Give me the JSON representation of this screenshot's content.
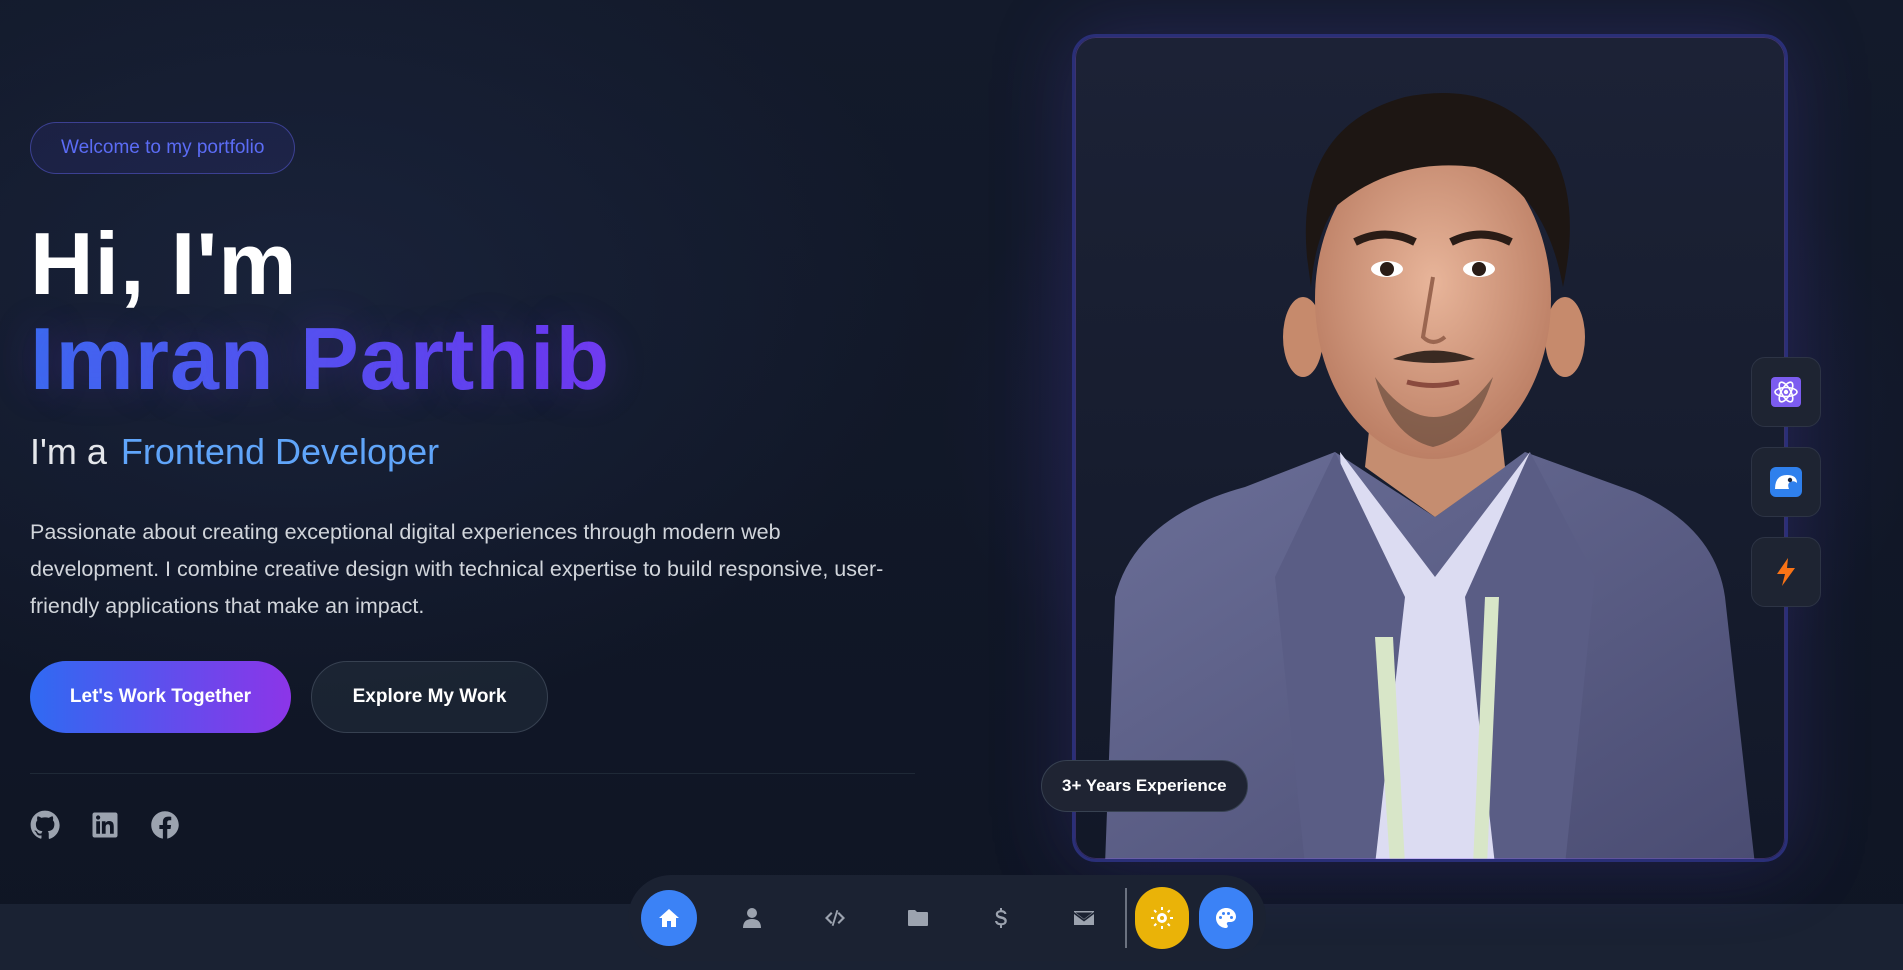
{
  "hero": {
    "badge": "Welcome to my portfolio",
    "greeting": "Hi, I'm",
    "name": "Imran Parthib",
    "role_prefix": "I'm a",
    "role": "Frontend Developer",
    "description": "Passionate about creating exceptional digital experiences through modern web development. I combine creative design with technical expertise to build responsive, user-friendly applications that make an impact.",
    "primary_cta": "Let's Work Together",
    "secondary_cta": "Explore My Work"
  },
  "socials": [
    {
      "icon": "github-icon"
    },
    {
      "icon": "linkedin-icon"
    },
    {
      "icon": "facebook-icon"
    }
  ],
  "profile": {
    "experience_badge": "3+ Years Experience"
  },
  "tech_icons": [
    "react-icon",
    "tailwind-icon",
    "bolt-icon"
  ],
  "dock": {
    "items": [
      "home-icon",
      "user-icon",
      "code-icon",
      "folder-icon",
      "dollar-icon",
      "mail-icon"
    ],
    "active": "home-icon",
    "theme_toggle": "sun-icon",
    "palette": "palette-icon"
  },
  "colors": {
    "accent_blue": "#3b82f6",
    "accent_purple": "#8c35e8",
    "role_blue": "#60a5fa",
    "theme_yellow": "#eab308"
  }
}
